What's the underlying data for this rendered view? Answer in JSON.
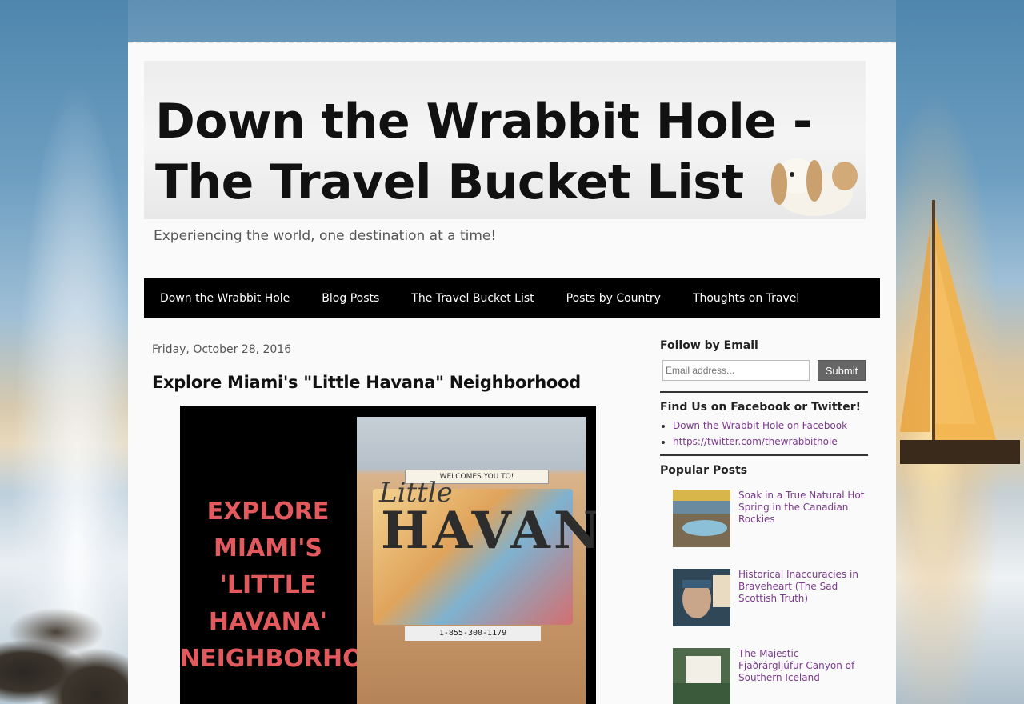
{
  "header": {
    "title_line1": "Down the Wrabbit Hole -",
    "title_line2": "The Travel Bucket List",
    "tagline": "Experiencing the world, one destination at a time!"
  },
  "nav": {
    "items": [
      {
        "label": "Down the Wrabbit Hole"
      },
      {
        "label": "Blog Posts"
      },
      {
        "label": "The Travel Bucket List"
      },
      {
        "label": "Posts by Country"
      },
      {
        "label": "Thoughts on Travel"
      }
    ]
  },
  "post": {
    "date": "Friday, October 28, 2016",
    "title": "Explore Miami's \"Little Havana\" Neighborhood",
    "image_text": "EXPLORE\nMIAMI'S 'LITTLE\nHAVANA'\nNEIGHBORHOOD",
    "mural_welcome": "WELCOMES YOU TO!",
    "mural_little": "Little",
    "mural_word": "HAVANA",
    "mural_phone": "1-855-300-1179"
  },
  "sidebar": {
    "follow_title": "Follow by Email",
    "email_placeholder": "Email address...",
    "submit_label": "Submit",
    "social_title": "Find Us on Facebook or Twitter!",
    "social_links": [
      {
        "label": "Down the Wrabbit Hole on Facebook"
      },
      {
        "label": "https://twitter.com/thewrabbithole"
      }
    ],
    "popular_title": "Popular Posts",
    "popular_posts": [
      {
        "title": "Soak in a True Natural Hot Spring in the Canadian Rockies"
      },
      {
        "title": "Historical Inaccuracies in Braveheart (The Sad Scottish Truth)"
      },
      {
        "title": "The Majestic Fjaðrárgljúfur Canyon of Southern Iceland"
      }
    ]
  }
}
